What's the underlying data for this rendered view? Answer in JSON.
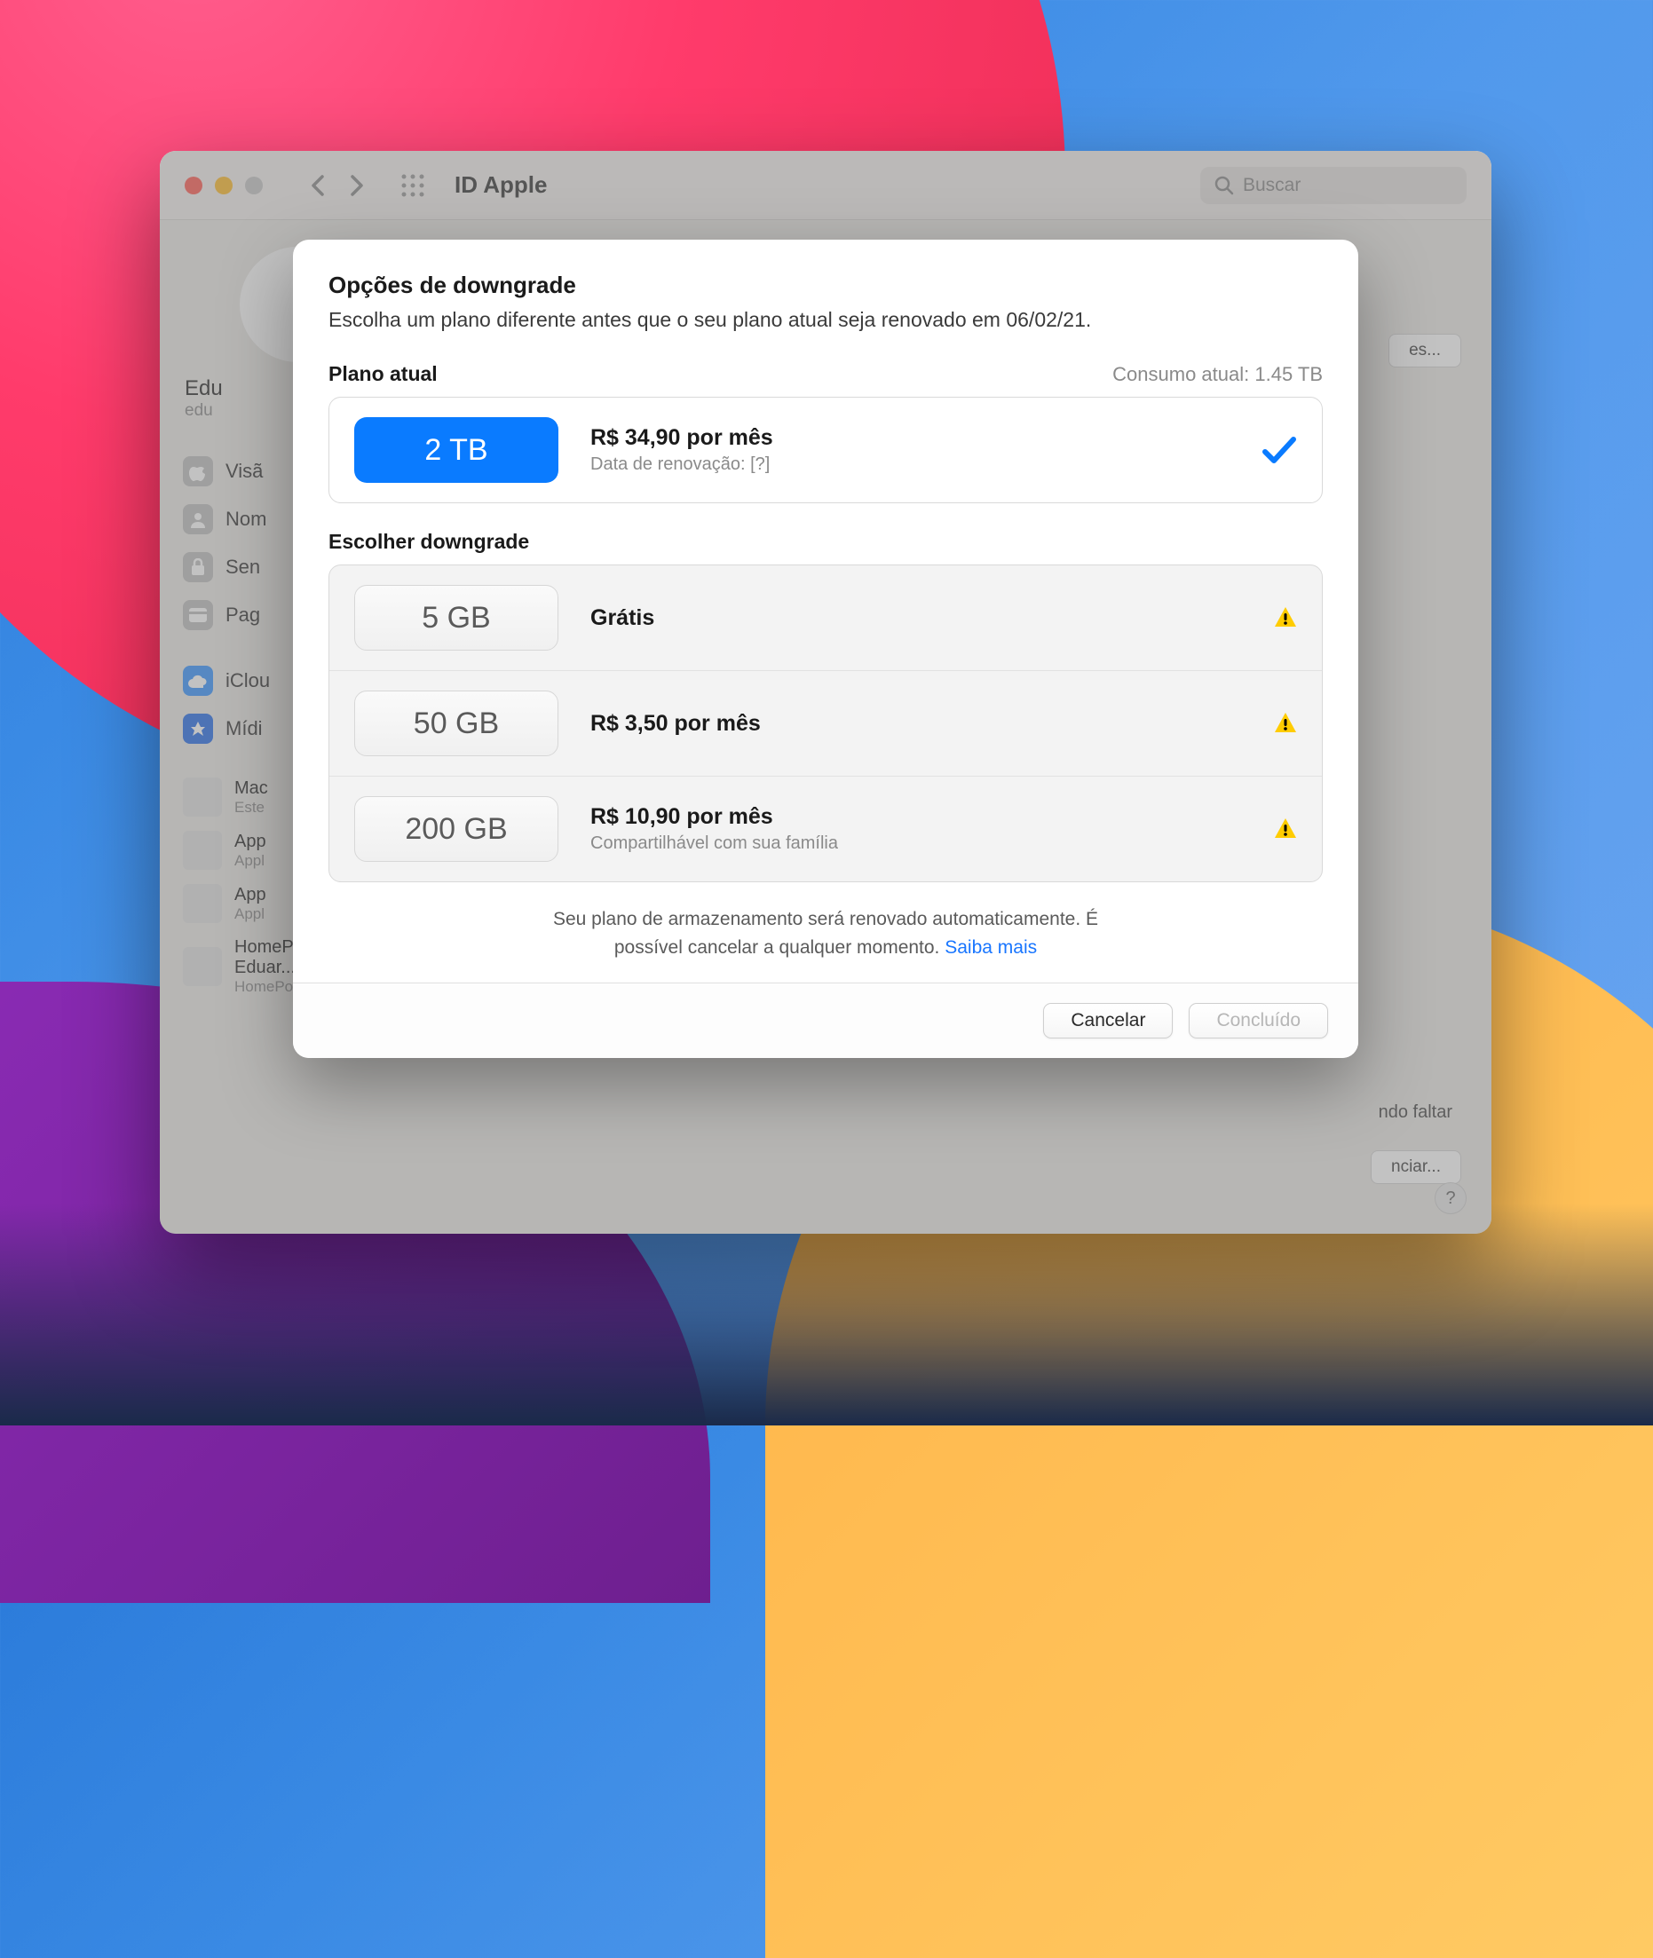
{
  "window": {
    "title": "ID Apple",
    "search_placeholder": "Buscar"
  },
  "sidebar": {
    "profile_name": "Edu",
    "profile_sub": "edu",
    "items": [
      {
        "label": "Visã"
      },
      {
        "label": "Nom"
      },
      {
        "label": "Sen"
      },
      {
        "label": "Pag"
      }
    ],
    "group2": [
      {
        "label": "iClou"
      },
      {
        "label": "Mídi"
      }
    ],
    "devices": [
      {
        "name": "Mac",
        "sub": "Este"
      },
      {
        "name": "App",
        "sub": "Appl"
      },
      {
        "name": "App",
        "sub": "Appl"
      },
      {
        "name": "HomePod de Eduar...",
        "sub": "HomePod"
      }
    ]
  },
  "bg_buttons": {
    "btn_faltar": "ndo faltar",
    "btn_iniciar": "nciar...",
    "btn_es": "es..."
  },
  "modal": {
    "title": "Opções de downgrade",
    "subtitle": "Escolha um plano diferente antes que o seu plano atual seja renovado em 06/02/21.",
    "current_section": "Plano atual",
    "usage_label": "Consumo atual: 1.45 TB",
    "current_plan": {
      "size": "2 TB",
      "price": "R$ 34,90 por mês",
      "detail": "Data de renovação: [?]"
    },
    "downgrade_section": "Escolher downgrade",
    "options": [
      {
        "size": "5 GB",
        "price": "Grátis",
        "detail": ""
      },
      {
        "size": "50 GB",
        "price": "R$ 3,50 por mês",
        "detail": ""
      },
      {
        "size": "200 GB",
        "price": "R$ 10,90 por mês",
        "detail": "Compartilhável com sua família"
      }
    ],
    "footer_text_1": "Seu plano de armazenamento será renovado automaticamente. É",
    "footer_text_2": "possível cancelar a qualquer momento. ",
    "footer_link": "Saiba mais",
    "cancel_btn": "Cancelar",
    "done_btn": "Concluído"
  }
}
